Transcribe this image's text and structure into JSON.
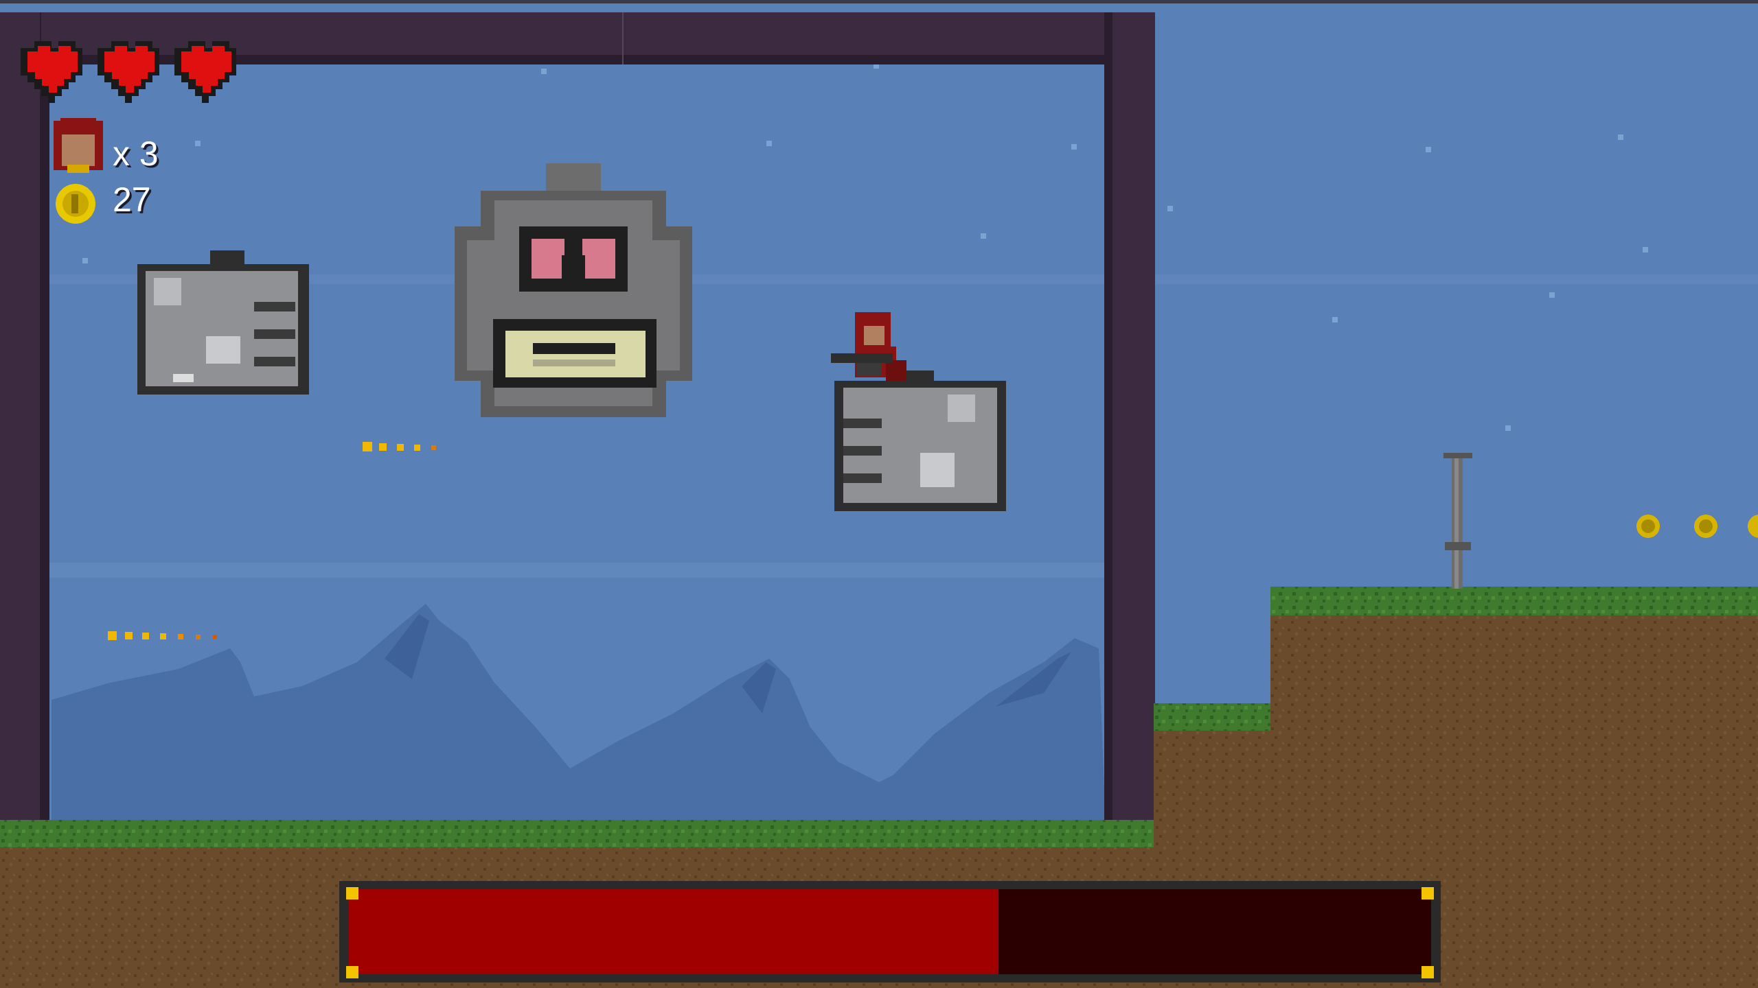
{
  "hud": {
    "hearts": 3,
    "lives_text": "x 3",
    "coins_text": "27"
  },
  "boss": {
    "health_fraction": 0.6
  },
  "colors": {
    "sky": "#5a80b8",
    "frame": "#3b2a40",
    "grass": "#3f7a2e",
    "dirt": "#6a4b2c",
    "boss_health_fill": "#a10000",
    "boss_health_empty": "#2b0000",
    "boss_health_corner": "#f5c400"
  },
  "icons": {
    "heart": "heart-icon",
    "player_head": "player-head-icon",
    "coin": "coin-icon"
  }
}
